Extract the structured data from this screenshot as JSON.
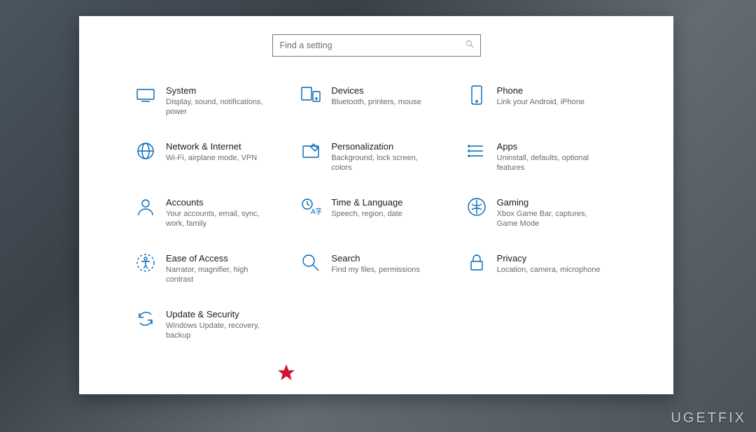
{
  "search": {
    "placeholder": "Find a setting"
  },
  "tiles": [
    {
      "key": "system",
      "title": "System",
      "desc": "Display, sound, notifications, power"
    },
    {
      "key": "devices",
      "title": "Devices",
      "desc": "Bluetooth, printers, mouse"
    },
    {
      "key": "phone",
      "title": "Phone",
      "desc": "Link your Android, iPhone"
    },
    {
      "key": "network",
      "title": "Network & Internet",
      "desc": "Wi-Fi, airplane mode, VPN"
    },
    {
      "key": "personalization",
      "title": "Personalization",
      "desc": "Background, lock screen, colors"
    },
    {
      "key": "apps",
      "title": "Apps",
      "desc": "Uninstall, defaults, optional features"
    },
    {
      "key": "accounts",
      "title": "Accounts",
      "desc": "Your accounts, email, sync, work, family"
    },
    {
      "key": "time",
      "title": "Time & Language",
      "desc": "Speech, region, date"
    },
    {
      "key": "gaming",
      "title": "Gaming",
      "desc": "Xbox Game Bar, captures, Game Mode"
    },
    {
      "key": "ease",
      "title": "Ease of Access",
      "desc": "Narrator, magnifier, high contrast"
    },
    {
      "key": "search",
      "title": "Search",
      "desc": "Find my files, permissions"
    },
    {
      "key": "privacy",
      "title": "Privacy",
      "desc": "Location, camera, microphone"
    },
    {
      "key": "update",
      "title": "Update & Security",
      "desc": "Windows Update, recovery, backup"
    }
  ],
  "watermark": "UGETFIX"
}
